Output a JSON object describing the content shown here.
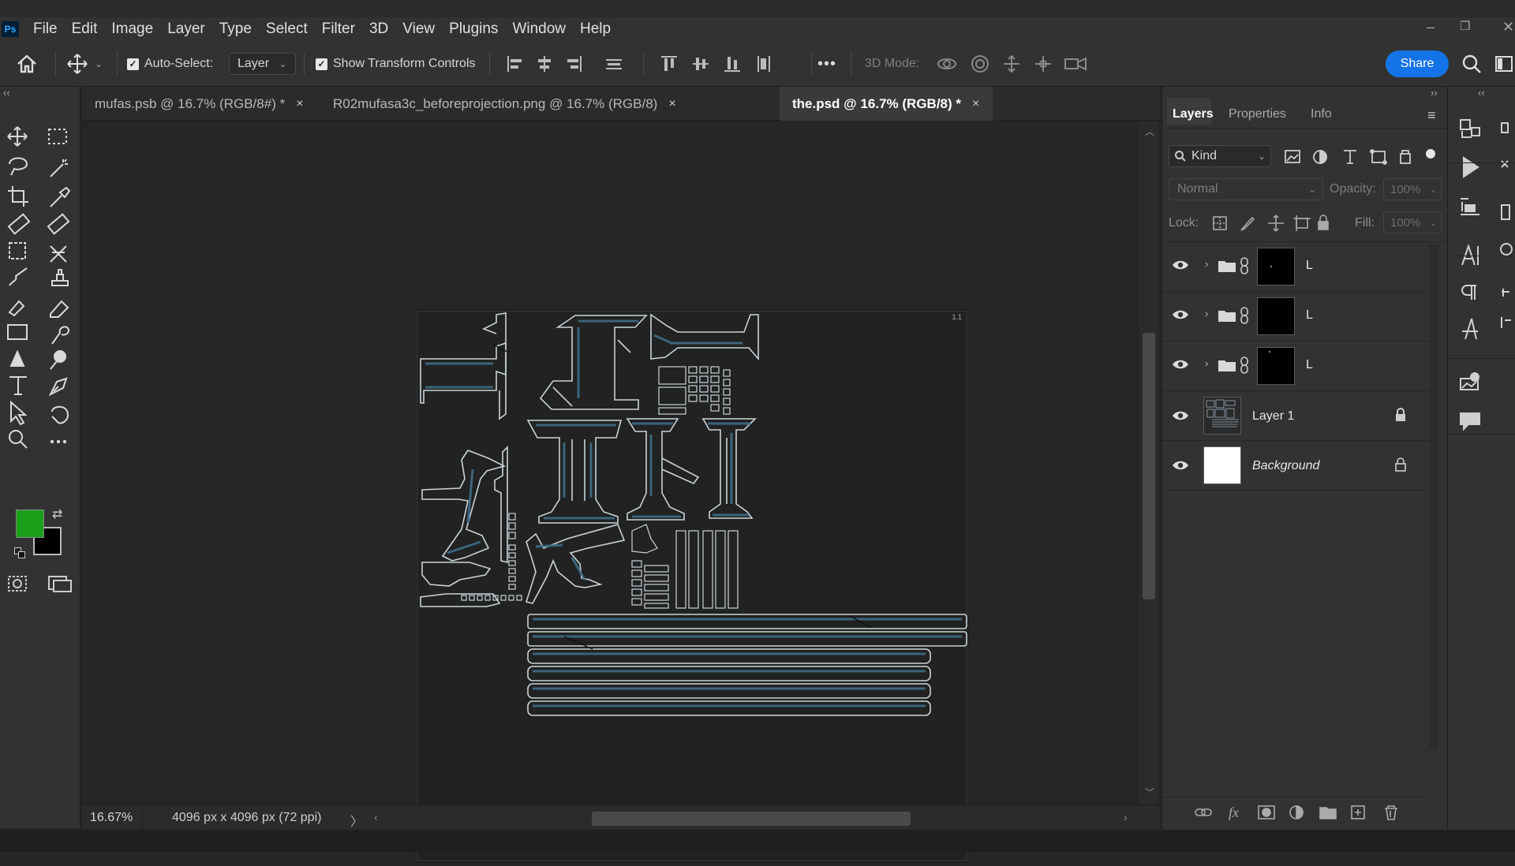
{
  "app": {
    "logo_text": "Ps"
  },
  "menu": [
    "File",
    "Edit",
    "Image",
    "Layer",
    "Type",
    "Select",
    "Filter",
    "3D",
    "View",
    "Plugins",
    "Window",
    "Help"
  ],
  "options": {
    "auto_select_label": "Auto-Select:",
    "auto_select_value": "Layer",
    "show_transform_label": "Show Transform Controls",
    "more_label": "•••",
    "mode_3d_label": "3D Mode:",
    "share_label": "Share"
  },
  "tabs": [
    {
      "label": "mufas.psb @ 16.7% (RGB/8#) *",
      "active": false
    },
    {
      "label": "R02mufasa3c_beforeprojection.png @ 16.7% (RGB/8)",
      "active": false
    },
    {
      "label": "the.psd @ 16.7% (RGB/8) *",
      "active": true
    }
  ],
  "tab_close": "×",
  "canvas": {
    "corner_mark": "1.1"
  },
  "status": {
    "zoom": "16.67%",
    "doc_info": "4096 px x 4096 px (72 ppi)",
    "arrow": "〉"
  },
  "colors": {
    "foreground": "#1aa01a",
    "background": "#000000",
    "accent": "#1473e6"
  },
  "layers_panel": {
    "tabs": [
      "Layers",
      "Properties",
      "Info"
    ],
    "filter_label": "Kind",
    "blend_mode": "Normal",
    "opacity_label": "Opacity:",
    "opacity_value": "100%",
    "lock_label": "Lock:",
    "fill_label": "Fill:",
    "fill_value": "100%",
    "layers": [
      {
        "name": "L",
        "type": "group",
        "thumb": "black"
      },
      {
        "name": "L",
        "type": "group",
        "thumb": "black"
      },
      {
        "name": "L",
        "type": "group",
        "thumb": "black"
      },
      {
        "name": "Layer 1",
        "type": "pixel",
        "thumb": "uv",
        "locked": true
      },
      {
        "name": "Background",
        "type": "background",
        "thumb": "white",
        "locked": true
      }
    ]
  }
}
